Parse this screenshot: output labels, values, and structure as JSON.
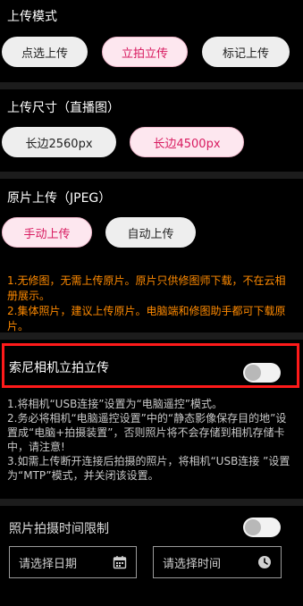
{
  "upload_mode": {
    "title": "上传模式",
    "options": [
      {
        "label": "点选上传",
        "active": false
      },
      {
        "label": "立拍立传",
        "active": true
      },
      {
        "label": "标记上传",
        "active": false
      }
    ]
  },
  "upload_size": {
    "title": "上传尺寸（直播图）",
    "options": [
      {
        "label": "长边2560px",
        "active": false
      },
      {
        "label": "长边4500px",
        "active": true
      }
    ]
  },
  "original_upload": {
    "title": "原片上传（JPEG）",
    "options": [
      {
        "label": "手动上传",
        "active": true
      },
      {
        "label": "自动上传",
        "active": false
      }
    ],
    "notes": [
      "1.无修图，无需上传原片。原片只供修图师下载，不在云相册展示。",
      "2.集体照片，建议上传原片。电脑端和修图助手都可下载原片。"
    ]
  },
  "sony": {
    "label": "索尼相机立拍立传",
    "enabled": false,
    "notes": [
      "1.将相机“USB连接”设置为“电脑遥控”模式。",
      "2.务必将相机“电脑遥控设置”中的“静态影像保存目的地”设置成“电脑+拍摄装置”，否则照片将不会存储到相机存储卡中，请注意!",
      "3.如需上传断开连接后拍摄的照片，将相机“USB连接 ”设置为“MTP”模式，并关闭该设置。"
    ]
  },
  "time_limit": {
    "label": "照片拍摄时间限制",
    "enabled": false,
    "date_placeholder": "请选择日期",
    "time_placeholder": "请选择时间"
  },
  "icons": {
    "date": "calendar-icon",
    "time": "clock-icon"
  },
  "colors": {
    "accent": "#d81b60",
    "warning": "#ff8a00",
    "highlight": "#ff1a1a"
  }
}
